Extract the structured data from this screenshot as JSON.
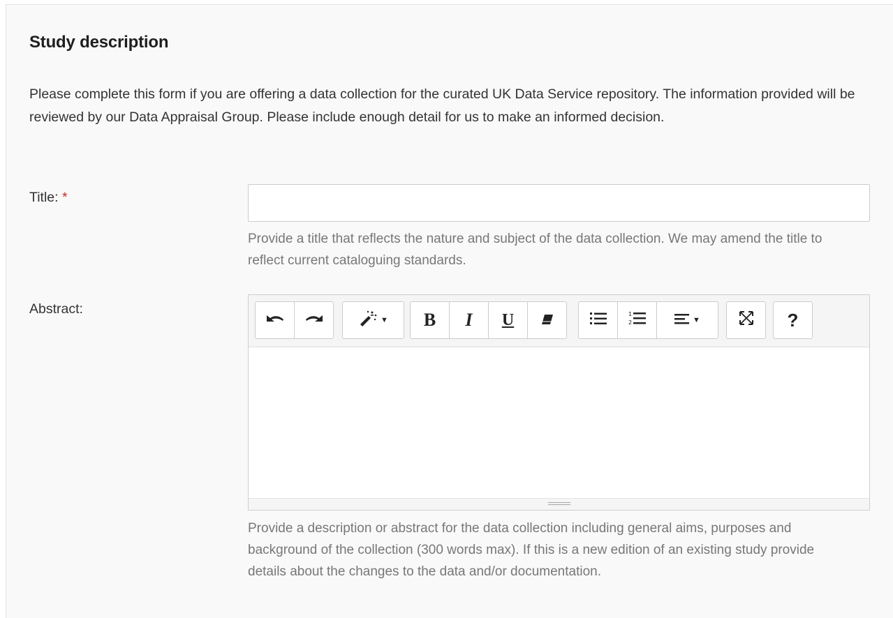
{
  "section": {
    "heading": "Study description",
    "intro": "Please complete this form if you are offering a data collection for the curated UK Data Service repository. The information provided will be reviewed by our Data Appraisal Group. Please include enough detail for us to make an informed decision."
  },
  "title_field": {
    "label": "Title:",
    "required_mark": "*",
    "value": "",
    "placeholder": "",
    "help": "Provide a title that reflects the nature and subject of the data collection. We may amend the title to reflect current cataloguing standards."
  },
  "abstract_field": {
    "label": "Abstract:",
    "value": "",
    "help": "Provide a description or abstract for the data collection including general aims, purposes and background of the collection (300 words max). If this is a new edition of an existing study provide details about the changes to the data and/or documentation.",
    "toolbar": {
      "undo_icon": "undo-icon",
      "redo_icon": "redo-icon",
      "style_icon": "magic-wand-icon",
      "bold_label": "B",
      "italic_label": "I",
      "underline_label": "U",
      "clear_format_icon": "eraser-icon",
      "unordered_list_icon": "bullet-list-icon",
      "ordered_list_icon": "numbered-list-icon",
      "paragraph_icon": "align-left-icon",
      "fullscreen_icon": "fullscreen-icon",
      "help_label": "?"
    }
  }
}
